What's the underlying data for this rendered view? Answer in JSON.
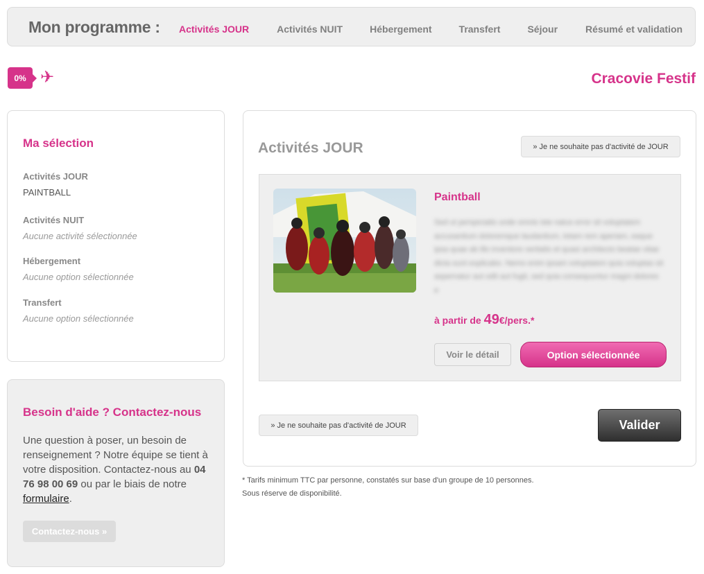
{
  "header": {
    "brand": "Mon programme :",
    "steps": [
      {
        "label": "Activités JOUR",
        "active": true
      },
      {
        "label": "Activités NUIT",
        "active": false
      },
      {
        "label": "Hébergement",
        "active": false
      },
      {
        "label": "Transfert",
        "active": false
      },
      {
        "label": "Séjour",
        "active": false
      },
      {
        "label": "Résumé et validation",
        "active": false
      }
    ]
  },
  "progress": {
    "label": "0%",
    "percent": 0,
    "icon": "airplane-icon"
  },
  "page_title": "Cracovie Festif",
  "selection": {
    "title": "Ma sélection",
    "groups": [
      {
        "label": "Activités JOUR",
        "value": "PAINTBALL"
      },
      {
        "label": "Activités NUIT",
        "value": "Aucune activité sélectionnée"
      },
      {
        "label": "Hébergement",
        "value": "Aucune option sélectionnée"
      },
      {
        "label": "Transfert",
        "value": "Aucune option sélectionnée"
      }
    ]
  },
  "help": {
    "title": "Besoin d'aide ? Contactez-nous",
    "text_before": "Une question à poser, un besoin de renseignement ? Notre équipe se tient à votre disposition. Contactez-nous au ",
    "phone": "04 76 98 00 69",
    "text_middle": " ou par le biais de notre ",
    "link": "formulaire",
    "text_after": ".",
    "button": "Contactez-nous »"
  },
  "main": {
    "title": "Activités JOUR",
    "skip_label": "» Je ne souhaite pas d'activité de JOUR",
    "activity": {
      "name": "Paintball",
      "description": "Sed ut perspiciatis unde omnis iste natus error sit voluptatem accusantium doloremque laudantium, totam rem aperiam, eaque ipsa quae ab illo inventore veritatis et quasi architecto beatae vitae dicta sunt explicabo. Nemo enim ipsam voluptatem quia voluptas sit aspernatur aut odit aut fugit, sed quia consequuntur magni dolores e",
      "price_prefix": "à partir de ",
      "price_amount": "49",
      "price_suffix": "€/pers.*",
      "detail_button": "Voir le détail",
      "selected_button": "Option sélectionnée"
    },
    "submit": "Valider"
  },
  "footnote": {
    "line1": "* Tarifs minimum TTC par personne, constatés sur base d'un groupe de 10 personnes.",
    "line2": "Sous réserve de disponibilité."
  },
  "colors": {
    "accent": "#d6338a",
    "panel_grey": "#efefef",
    "border": "#dcdcdc"
  }
}
